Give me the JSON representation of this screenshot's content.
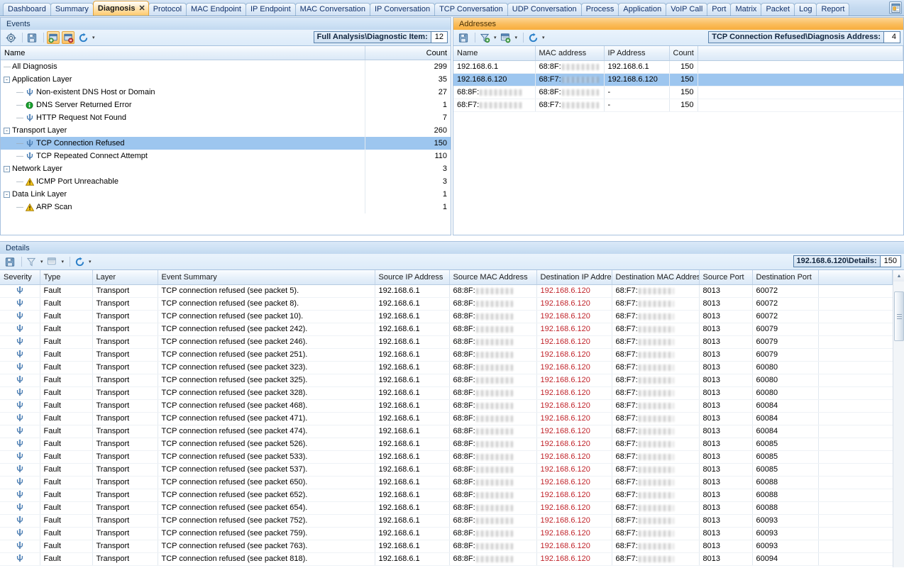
{
  "tabs": [
    {
      "label": "Dashboard",
      "active": false
    },
    {
      "label": "Summary",
      "active": false
    },
    {
      "label": "Diagnosis",
      "active": true,
      "close": "✕"
    },
    {
      "label": "Protocol",
      "active": false
    },
    {
      "label": "MAC Endpoint",
      "active": false
    },
    {
      "label": "IP Endpoint",
      "active": false
    },
    {
      "label": "MAC Conversation",
      "active": false
    },
    {
      "label": "IP Conversation",
      "active": false
    },
    {
      "label": "TCP Conversation",
      "active": false
    },
    {
      "label": "UDP Conversation",
      "active": false
    },
    {
      "label": "Process",
      "active": false
    },
    {
      "label": "Application",
      "active": false
    },
    {
      "label": "VoIP Call",
      "active": false
    },
    {
      "label": "Port",
      "active": false
    },
    {
      "label": "Matrix",
      "active": false
    },
    {
      "label": "Packet",
      "active": false
    },
    {
      "label": "Log",
      "active": false
    },
    {
      "label": "Report",
      "active": false
    }
  ],
  "tabbar": {
    "right_icon": "report-window-icon"
  },
  "events_panel": {
    "title": "Events",
    "active": false,
    "toolbar": {
      "icons": [
        "settings-gear-icon",
        "save-icon",
        "add-filter-icon",
        "remove-filter-icon",
        "refresh-icon"
      ],
      "refresh_caret": "▾"
    },
    "counter": {
      "label": "Full Analysis\\Diagnostic Item:",
      "value": "12"
    },
    "columns": [
      "Name",
      "Count"
    ],
    "rows": [
      {
        "label": "All Diagnosis",
        "count": "299",
        "depth": 0,
        "expander": "",
        "icon": "",
        "selected": false
      },
      {
        "label": "Application Layer",
        "count": "35",
        "depth": 0,
        "expander": "-",
        "icon": "",
        "selected": false
      },
      {
        "label": "Non-existent DNS Host or Domain",
        "count": "27",
        "depth": 1,
        "expander": "",
        "icon": "fault-icon",
        "selected": false
      },
      {
        "label": "DNS Server Returned Error",
        "count": "1",
        "depth": 1,
        "expander": "",
        "icon": "info-icon",
        "selected": false
      },
      {
        "label": "HTTP Request Not Found",
        "count": "7",
        "depth": 1,
        "expander": "",
        "icon": "fault-icon",
        "selected": false
      },
      {
        "label": "Transport Layer",
        "count": "260",
        "depth": 0,
        "expander": "-",
        "icon": "",
        "selected": false
      },
      {
        "label": "TCP Connection Refused",
        "count": "150",
        "depth": 1,
        "expander": "",
        "icon": "fault-icon",
        "selected": true
      },
      {
        "label": "TCP Repeated Connect Attempt",
        "count": "110",
        "depth": 1,
        "expander": "",
        "icon": "fault-icon",
        "selected": false
      },
      {
        "label": "Network Layer",
        "count": "3",
        "depth": 0,
        "expander": "-",
        "icon": "",
        "selected": false
      },
      {
        "label": "ICMP Port Unreachable",
        "count": "3",
        "depth": 1,
        "expander": "",
        "icon": "warning-icon",
        "selected": false
      },
      {
        "label": "Data Link Layer",
        "count": "1",
        "depth": 0,
        "expander": "-",
        "icon": "",
        "selected": false
      },
      {
        "label": "ARP Scan",
        "count": "1",
        "depth": 1,
        "expander": "",
        "icon": "warning-icon",
        "selected": false
      }
    ]
  },
  "addresses_panel": {
    "title": "Addresses",
    "active": true,
    "toolbar": {
      "icons": [
        "save-icon",
        "filter-icon",
        "make-filter-icon",
        "refresh-icon"
      ],
      "carets": "▾"
    },
    "counter": {
      "label": "TCP Connection Refused\\Diagnosis Address:",
      "value": "4"
    },
    "columns": [
      "Name",
      "MAC address",
      "IP Address",
      "Count"
    ],
    "rows": [
      {
        "name": "192.168.6.1",
        "name_redacted": false,
        "mac_prefix": "68:8F:",
        "ip": "192.168.6.1",
        "count": "150",
        "selected": false
      },
      {
        "name": "192.168.6.120",
        "name_redacted": false,
        "mac_prefix": "68:F7:",
        "ip": "192.168.6.120",
        "count": "150",
        "selected": true
      },
      {
        "name": "68:8F:",
        "name_redacted": true,
        "mac_prefix": "68:8F:",
        "ip": "-",
        "count": "150",
        "selected": false
      },
      {
        "name": "68:F7:",
        "name_redacted": true,
        "mac_prefix": "68:F7:",
        "ip": "-",
        "count": "150",
        "selected": false
      }
    ]
  },
  "details_panel": {
    "title": "Details",
    "active": false,
    "toolbar": {
      "icons": [
        "save-icon",
        "filter-icon",
        "make-filter-icon",
        "refresh-icon"
      ],
      "carets": "▾"
    },
    "counter": {
      "label": "192.168.6.120\\Details:",
      "value": "150"
    },
    "columns": [
      "Severity",
      "Type",
      "Layer",
      "Event Summary",
      "Source IP Address",
      "Source MAC Address",
      "Destination IP Address",
      "Destination MAC Address",
      "Source Port",
      "Destination Port"
    ],
    "rows": [
      {
        "severity": "fault-icon",
        "type": "Fault",
        "layer": "Transport",
        "summary": "TCP connection refused (see packet 5).",
        "src_ip": "192.168.6.1",
        "src_mac": "68:8F:",
        "dst_ip": "192.168.6.120",
        "dst_mac": "68:F7:",
        "src_port": "8013",
        "dst_port": "60072"
      },
      {
        "severity": "fault-icon",
        "type": "Fault",
        "layer": "Transport",
        "summary": "TCP connection refused (see packet 8).",
        "src_ip": "192.168.6.1",
        "src_mac": "68:8F:",
        "dst_ip": "192.168.6.120",
        "dst_mac": "68:F7:",
        "src_port": "8013",
        "dst_port": "60072"
      },
      {
        "severity": "fault-icon",
        "type": "Fault",
        "layer": "Transport",
        "summary": "TCP connection refused (see packet 10).",
        "src_ip": "192.168.6.1",
        "src_mac": "68:8F:",
        "dst_ip": "192.168.6.120",
        "dst_mac": "68:F7:",
        "src_port": "8013",
        "dst_port": "60072"
      },
      {
        "severity": "fault-icon",
        "type": "Fault",
        "layer": "Transport",
        "summary": "TCP connection refused (see packet 242).",
        "src_ip": "192.168.6.1",
        "src_mac": "68:8F:",
        "dst_ip": "192.168.6.120",
        "dst_mac": "68:F7:",
        "src_port": "8013",
        "dst_port": "60079"
      },
      {
        "severity": "fault-icon",
        "type": "Fault",
        "layer": "Transport",
        "summary": "TCP connection refused (see packet 246).",
        "src_ip": "192.168.6.1",
        "src_mac": "68:8F:",
        "dst_ip": "192.168.6.120",
        "dst_mac": "68:F7:",
        "src_port": "8013",
        "dst_port": "60079"
      },
      {
        "severity": "fault-icon",
        "type": "Fault",
        "layer": "Transport",
        "summary": "TCP connection refused (see packet 251).",
        "src_ip": "192.168.6.1",
        "src_mac": "68:8F:",
        "dst_ip": "192.168.6.120",
        "dst_mac": "68:F7:",
        "src_port": "8013",
        "dst_port": "60079"
      },
      {
        "severity": "fault-icon",
        "type": "Fault",
        "layer": "Transport",
        "summary": "TCP connection refused (see packet 323).",
        "src_ip": "192.168.6.1",
        "src_mac": "68:8F:",
        "dst_ip": "192.168.6.120",
        "dst_mac": "68:F7:",
        "src_port": "8013",
        "dst_port": "60080"
      },
      {
        "severity": "fault-icon",
        "type": "Fault",
        "layer": "Transport",
        "summary": "TCP connection refused (see packet 325).",
        "src_ip": "192.168.6.1",
        "src_mac": "68:8F:",
        "dst_ip": "192.168.6.120",
        "dst_mac": "68:F7:",
        "src_port": "8013",
        "dst_port": "60080"
      },
      {
        "severity": "fault-icon",
        "type": "Fault",
        "layer": "Transport",
        "summary": "TCP connection refused (see packet 328).",
        "src_ip": "192.168.6.1",
        "src_mac": "68:8F:",
        "dst_ip": "192.168.6.120",
        "dst_mac": "68:F7:",
        "src_port": "8013",
        "dst_port": "60080"
      },
      {
        "severity": "fault-icon",
        "type": "Fault",
        "layer": "Transport",
        "summary": "TCP connection refused (see packet 468).",
        "src_ip": "192.168.6.1",
        "src_mac": "68:8F:",
        "dst_ip": "192.168.6.120",
        "dst_mac": "68:F7:",
        "src_port": "8013",
        "dst_port": "60084"
      },
      {
        "severity": "fault-icon",
        "type": "Fault",
        "layer": "Transport",
        "summary": "TCP connection refused (see packet 471).",
        "src_ip": "192.168.6.1",
        "src_mac": "68:8F:",
        "dst_ip": "192.168.6.120",
        "dst_mac": "68:F7:",
        "src_port": "8013",
        "dst_port": "60084"
      },
      {
        "severity": "fault-icon",
        "type": "Fault",
        "layer": "Transport",
        "summary": "TCP connection refused (see packet 474).",
        "src_ip": "192.168.6.1",
        "src_mac": "68:8F:",
        "dst_ip": "192.168.6.120",
        "dst_mac": "68:F7:",
        "src_port": "8013",
        "dst_port": "60084"
      },
      {
        "severity": "fault-icon",
        "type": "Fault",
        "layer": "Transport",
        "summary": "TCP connection refused (see packet 526).",
        "src_ip": "192.168.6.1",
        "src_mac": "68:8F:",
        "dst_ip": "192.168.6.120",
        "dst_mac": "68:F7:",
        "src_port": "8013",
        "dst_port": "60085"
      },
      {
        "severity": "fault-icon",
        "type": "Fault",
        "layer": "Transport",
        "summary": "TCP connection refused (see packet 533).",
        "src_ip": "192.168.6.1",
        "src_mac": "68:8F:",
        "dst_ip": "192.168.6.120",
        "dst_mac": "68:F7:",
        "src_port": "8013",
        "dst_port": "60085"
      },
      {
        "severity": "fault-icon",
        "type": "Fault",
        "layer": "Transport",
        "summary": "TCP connection refused (see packet 537).",
        "src_ip": "192.168.6.1",
        "src_mac": "68:8F:",
        "dst_ip": "192.168.6.120",
        "dst_mac": "68:F7:",
        "src_port": "8013",
        "dst_port": "60085"
      },
      {
        "severity": "fault-icon",
        "type": "Fault",
        "layer": "Transport",
        "summary": "TCP connection refused (see packet 650).",
        "src_ip": "192.168.6.1",
        "src_mac": "68:8F:",
        "dst_ip": "192.168.6.120",
        "dst_mac": "68:F7:",
        "src_port": "8013",
        "dst_port": "60088"
      },
      {
        "severity": "fault-icon",
        "type": "Fault",
        "layer": "Transport",
        "summary": "TCP connection refused (see packet 652).",
        "src_ip": "192.168.6.1",
        "src_mac": "68:8F:",
        "dst_ip": "192.168.6.120",
        "dst_mac": "68:F7:",
        "src_port": "8013",
        "dst_port": "60088"
      },
      {
        "severity": "fault-icon",
        "type": "Fault",
        "layer": "Transport",
        "summary": "TCP connection refused (see packet 654).",
        "src_ip": "192.168.6.1",
        "src_mac": "68:8F:",
        "dst_ip": "192.168.6.120",
        "dst_mac": "68:F7:",
        "src_port": "8013",
        "dst_port": "60088"
      },
      {
        "severity": "fault-icon",
        "type": "Fault",
        "layer": "Transport",
        "summary": "TCP connection refused (see packet 752).",
        "src_ip": "192.168.6.1",
        "src_mac": "68:8F:",
        "dst_ip": "192.168.6.120",
        "dst_mac": "68:F7:",
        "src_port": "8013",
        "dst_port": "60093"
      },
      {
        "severity": "fault-icon",
        "type": "Fault",
        "layer": "Transport",
        "summary": "TCP connection refused (see packet 759).",
        "src_ip": "192.168.6.1",
        "src_mac": "68:8F:",
        "dst_ip": "192.168.6.120",
        "dst_mac": "68:F7:",
        "src_port": "8013",
        "dst_port": "60093"
      },
      {
        "severity": "fault-icon",
        "type": "Fault",
        "layer": "Transport",
        "summary": "TCP connection refused (see packet 763).",
        "src_ip": "192.168.6.1",
        "src_mac": "68:8F:",
        "dst_ip": "192.168.6.120",
        "dst_mac": "68:F7:",
        "src_port": "8013",
        "dst_port": "60093"
      },
      {
        "severity": "fault-icon",
        "type": "Fault",
        "layer": "Transport",
        "summary": "TCP connection refused (see packet 818).",
        "src_ip": "192.168.6.1",
        "src_mac": "68:8F:",
        "dst_ip": "192.168.6.120",
        "dst_mac": "68:F7:",
        "src_port": "8013",
        "dst_port": "60094"
      }
    ]
  },
  "colors": {
    "selection": "#9dc6ef",
    "active_panel_header": "#f8ad3c",
    "inactive_panel_header": "#cfe2f5",
    "destination_ip_text": "#c0242b",
    "warning_icon": "#f2c018",
    "info_icon": "#14a02e",
    "fault_icon": "#3b6ea5"
  }
}
